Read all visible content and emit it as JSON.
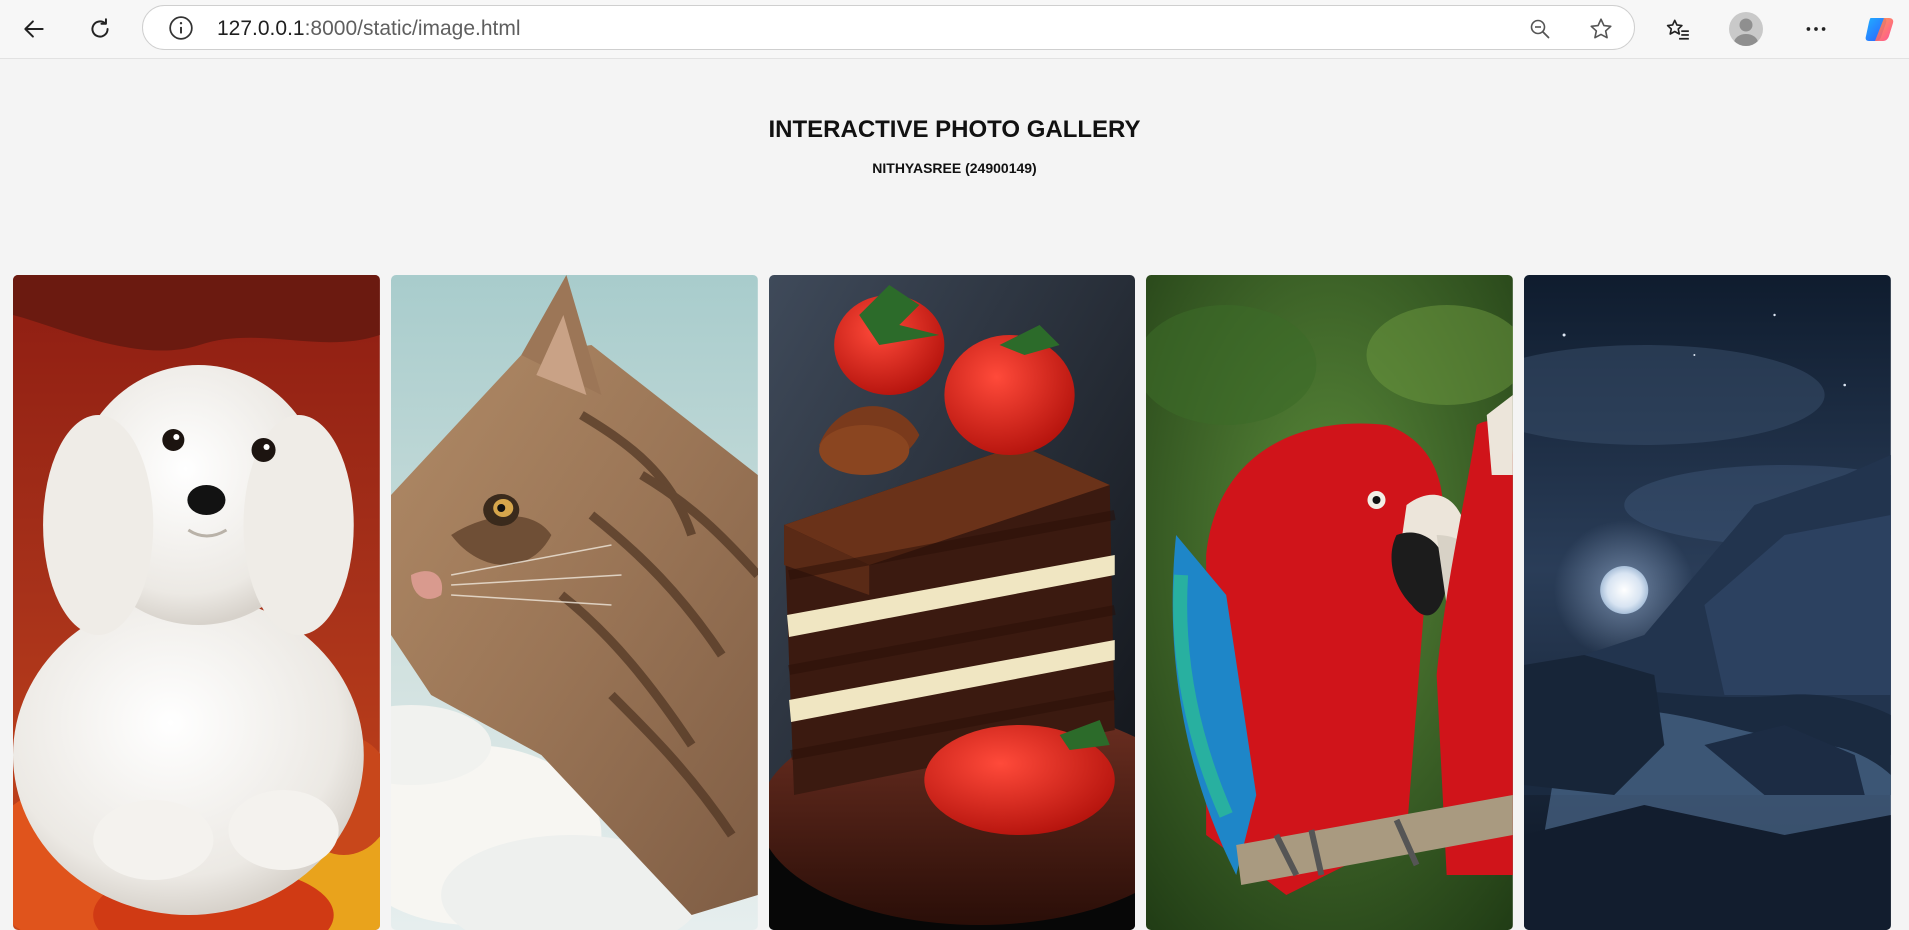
{
  "browser": {
    "url_host": "127.0.0.1",
    "url_rest": ":8000/static/image.html"
  },
  "page": {
    "title": "INTERACTIVE PHOTO GALLERY",
    "subtitle": "NITHYASREE (24900149)"
  },
  "gallery": {
    "photos": [
      {
        "subject": "white puppy on autumn leaves"
      },
      {
        "subject": "tabby cat against sky"
      },
      {
        "subject": "chocolate cake slice with strawberries"
      },
      {
        "subject": "scarlet macaw parrots"
      },
      {
        "subject": "moonlit night landscape with river"
      }
    ]
  },
  "icons": {
    "back": "back-arrow-icon",
    "reload": "reload-icon",
    "info": "info-icon",
    "zoom": "zoom-out-icon",
    "star": "star-icon",
    "favorites": "favorites-icon",
    "profile": "profile-icon",
    "more": "more-icon",
    "copilot": "copilot-icon"
  }
}
